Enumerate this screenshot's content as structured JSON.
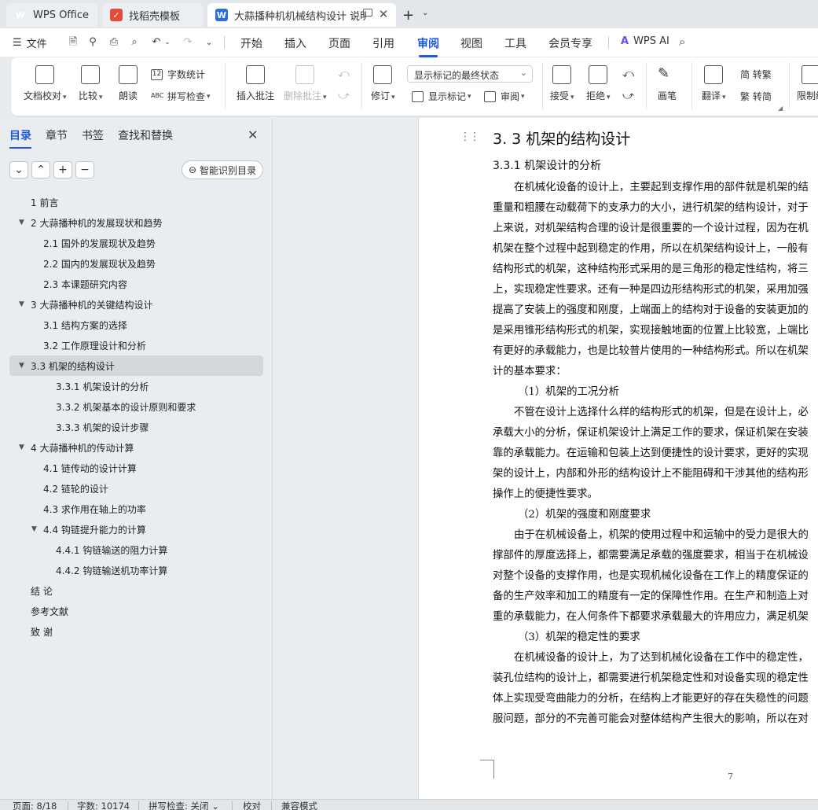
{
  "tabs": [
    {
      "label": "WPS Office",
      "icon": "wps-logo-icon"
    },
    {
      "label": "找稻壳模板",
      "icon": "docer-icon"
    },
    {
      "label": "大蒜播种机机械结构设计 说明",
      "icon": "writer-doc-icon"
    }
  ],
  "menu": {
    "file": "文件",
    "items": [
      "开始",
      "插入",
      "页面",
      "引用",
      "审阅",
      "视图",
      "工具",
      "会员专享"
    ],
    "active": "审阅",
    "ai": "WPS AI"
  },
  "ribbon": {
    "doc_check": "文档校对",
    "compare": "比较",
    "read_aloud": "朗读",
    "word_count": "字数统计",
    "spell_check": "拼写检查",
    "insert_comment": "插入批注",
    "delete_comment": "删除批注",
    "revise": "修订",
    "markup_state": "显示标记的最终状态",
    "show_markup": "显示标记",
    "review": "审阅",
    "accept": "接受",
    "reject": "拒绝",
    "pen": "画笔",
    "translate": "翻译",
    "to_traditional": "简 转繁",
    "to_simplified": "繁 转简",
    "restrict": "限制编"
  },
  "nav": {
    "tabs": [
      "目录",
      "章节",
      "书签",
      "查找和替换"
    ],
    "active_tab": "目录",
    "smart_toc": "智能识别目录",
    "toc": [
      {
        "label": "1  前言",
        "level": 1,
        "expand": ""
      },
      {
        "label": "2  大蒜播种机的发展现状和趋势",
        "level": 1,
        "expand": "▼"
      },
      {
        "label": "2.1  国外的发展现状及趋势",
        "level": 2,
        "expand": ""
      },
      {
        "label": "2.2  国内的发展现状及趋势",
        "level": 2,
        "expand": ""
      },
      {
        "label": "2.3  本课题研究内容",
        "level": 2,
        "expand": ""
      },
      {
        "label": "3  大蒜播种机的关键结构设计",
        "level": 1,
        "expand": "▼"
      },
      {
        "label": "3.1 结构方案的选择",
        "level": 2,
        "expand": ""
      },
      {
        "label": "3.2  工作原理设计和分析",
        "level": 2,
        "expand": ""
      },
      {
        "label": "3.3 机架的结构设计",
        "level": 1,
        "expand": "▼",
        "selected": true
      },
      {
        "label": "3.3.1 机架设计的分析",
        "level": 3,
        "expand": ""
      },
      {
        "label": "3.3.2 机架基本的设计原则和要求",
        "level": 3,
        "expand": ""
      },
      {
        "label": "3.3.3 机架的设计步骤",
        "level": 3,
        "expand": ""
      },
      {
        "label": "4  大蒜播种机的传动计算",
        "level": 1,
        "expand": "▼"
      },
      {
        "label": "4.1 链传动的设计计算",
        "level": 2,
        "expand": ""
      },
      {
        "label": "4.2 链轮的设计",
        "level": 2,
        "expand": ""
      },
      {
        "label": "4.3 求作用在轴上的功率",
        "level": 2,
        "expand": ""
      },
      {
        "label": "4.4 钩链提升能力的计算",
        "level": 2,
        "expand": "▼"
      },
      {
        "label": "4.4.1 钩链输送的阻力计算",
        "level": 3,
        "expand": ""
      },
      {
        "label": "4.4.2 钩链输送机功率计算",
        "level": 3,
        "expand": ""
      },
      {
        "label": "结  论",
        "level": 1,
        "expand": ""
      },
      {
        "label": "参考文献",
        "level": 1,
        "expand": ""
      },
      {
        "label": "致  谢",
        "level": 1,
        "expand": ""
      }
    ]
  },
  "document": {
    "heading": "3. 3 机架的结构设计",
    "subheading": "3.3.1 机架设计的分析",
    "lines": [
      {
        "text": "在机械化设备的设计上，主要起到支撑作用的部件就是机架的结",
        "style": "ind"
      },
      {
        "text": "重量和粗腰在动载荷下的支承力的大小，进行机架的结构设计，对于",
        "style": ""
      },
      {
        "text": "上来说，对机架结构合理的设计是很重要的一个设计过程，因为在机",
        "style": ""
      },
      {
        "text": "机架在整个过程中起到稳定的作用，所以在机架结构设计上，一般有",
        "style": ""
      },
      {
        "text": "结构形式的机架，这种结构形式采用的是三角形的稳定性结构，将三",
        "style": ""
      },
      {
        "text": "上，实现稳定性要求。还有一种是四边形结构形式的机架，采用加强",
        "style": ""
      },
      {
        "text": "提高了安装上的强度和刚度，上端面上的结构对于设备的安装更加的",
        "style": ""
      },
      {
        "text": "是采用锥形结构形式的机架，实现接触地面的位置上比较宽，上端比",
        "style": ""
      },
      {
        "text": "有更好的承载能力，也是比较普片使用的一种结构形式。所以在机架",
        "style": ""
      },
      {
        "text": "计的基本要求：",
        "style": ""
      },
      {
        "text": "（1）机架的工况分析",
        "style": "sub"
      },
      {
        "text": "不管在设计上选择什么样的结构形式的机架，但是在设计上，必",
        "style": "ind"
      },
      {
        "text": "承载大小的分析，保证机架设计上满足工作的要求，保证机架在安装",
        "style": ""
      },
      {
        "text": "靠的承载能力。在运输和包装上达到便捷性的设计要求，更好的实现",
        "style": ""
      },
      {
        "text": "架的设计上，内部和外形的结构设计上不能阻碍和干涉其他的结构形",
        "style": ""
      },
      {
        "text": "操作上的便捷性要求。",
        "style": ""
      },
      {
        "text": "（2）机架的强度和刚度要求",
        "style": "sub"
      },
      {
        "text": "由于在机械设备上，机架的使用过程中和运输中的受力是很大的",
        "style": "ind"
      },
      {
        "text": "撑部件的厚度选择上，都需要满足承载的强度要求，相当于在机械设",
        "style": ""
      },
      {
        "text": "对整个设备的支撑作用，也是实现机械化设备在工作上的精度保证的",
        "style": ""
      },
      {
        "text": "备的生产效率和加工的精度有一定的保障性作用。在生产和制造上对",
        "style": ""
      },
      {
        "text": "重的承载能力，在人何条件下都要求承载最大的许用应力，满足机架",
        "style": ""
      },
      {
        "text": "（3）机架的稳定性的要求",
        "style": "sub"
      },
      {
        "text": "在机械设备的设计上，为了达到机械化设备在工作中的稳定性，",
        "style": "ind"
      },
      {
        "text": "装孔位结构的设计上，都需要进行机架稳定性和对设备实现的稳定性",
        "style": ""
      },
      {
        "text": "体上实现受弯曲能力的分析，在结构上才能更好的存在失稳性的问题",
        "style": ""
      },
      {
        "text": "服问题，部分的不完善可能会对整体结构产生很大的影响，所以在对",
        "style": ""
      }
    ],
    "page_number": "7"
  },
  "status": {
    "page": "页面: 8/18",
    "words": "字数: 10174",
    "spell": "拼写检查: 关闭",
    "proof": "校对",
    "compat": "兼容模式"
  }
}
